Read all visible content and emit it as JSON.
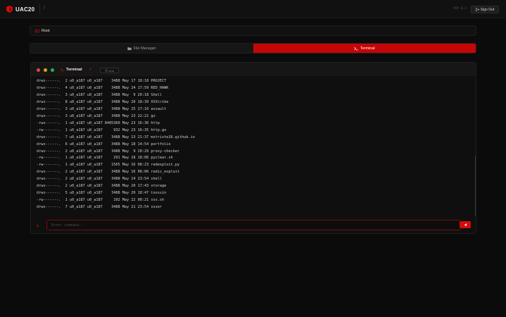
{
  "brand": {
    "name": "UAC20",
    "accent": "#d40b0b"
  },
  "topbar": {
    "path": "/",
    "meta": "PHP 8.3",
    "signout_label": "Sign Out"
  },
  "breadcrumb": {
    "root_label": "Root"
  },
  "tabs": [
    {
      "label": "File Manager",
      "icon": "folder-icon",
      "active": false
    },
    {
      "label": "Terminal",
      "icon": "terminal-icon",
      "active": true
    }
  ],
  "terminal": {
    "title": "Terminal",
    "mark": "/",
    "clear_label": "clear",
    "prompt": "$",
    "input_value": "",
    "input_placeholder": "Enter command...",
    "lines": [
      "drwx------.  2 u0_a187 u0_a187    3488 May 17 18:18 PROJECT",
      "drwx------.  4 u0_a187 u0_a187    3488 May 24 17:59 RED_HAWK",
      "drwx------.  3 u0_a187 u0_a187    3488 May  9 20:18 Shell",
      "drwx------.  8 u0_a187 u0_a187    3488 May 20 18:39 XSStrike",
      "drwx------.  3 u0_a187 u0_a187    3488 May 25 17:10 assault",
      "drwx------.  3 u0_a187 u0_a187    3488 May 23 22:21 go",
      "-rwx------.  1 u0_a187 u0_a187 8405360 May 23 16:36 http",
      "-rw-------.  1 u0_a187 u0_a187     932 May 23 16:35 http.go",
      "drwx------.  7 u0_a187 u0_a187    3488 May 13 21:37 mztrixte26.github.io",
      "drwx------.  6 u0_a187 u0_a187    3488 May 18 14:54 portfolio",
      "drwx------.  2 u0_a187 u0_a187    3488 May  9 20:29 proxy-checker",
      "-rw-------.  1 u0_a187 u0_a187     291 May 18 18:06 pyclear.sh",
      "-rw-------.  1 u0_a187 u0_a187    1565 May 16 08:23 redexploit.py",
      "drwx------.  2 u0_a187 u0_a187    3488 May 16 08:06 redis_exploit",
      "drwx------.  2 u0_a187 u0_a187    3488 May 14 23:54 shell",
      "drwx------.  2 u0_a187 u0_a187    3488 May 20 17:43 storage",
      "drwx------.  5 u0_a187 u0_a187    3488 May 20 18:47 toxssin",
      "-rw-------.  1 u0_a187 u0_a187     102 May 22 08:21 xss.sh",
      "drwx------.  7 u0_a187 u0_a187    3488 May 21 23:54 xsser"
    ]
  }
}
